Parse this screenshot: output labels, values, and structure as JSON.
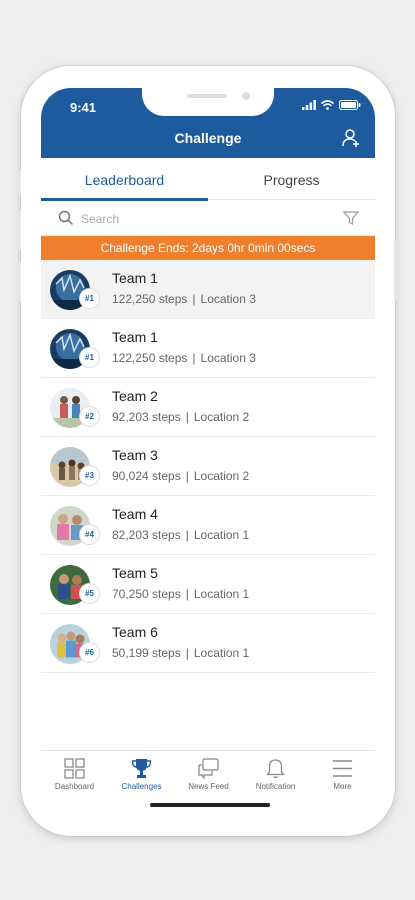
{
  "status_bar": {
    "time": "9:41"
  },
  "header": {
    "title": "Challenge"
  },
  "tabs": [
    {
      "label": "Leaderboard",
      "active": true
    },
    {
      "label": "Progress",
      "active": false
    }
  ],
  "search": {
    "placeholder": "Search",
    "value": ""
  },
  "banner": {
    "text": "Challenge Ends: 2days 0hr 0min 00secs"
  },
  "colors": {
    "primary": "#1d5a9e",
    "accent": "#f07f2d"
  },
  "teams": [
    {
      "rank": "#1",
      "name": "Team 1",
      "steps": "122,250 steps",
      "location": "Location 3"
    },
    {
      "rank": "#1",
      "name": "Team 1",
      "steps": "122,250 steps",
      "location": "Location 3"
    },
    {
      "rank": "#2",
      "name": "Team 2",
      "steps": "92,203 steps",
      "location": "Location 2"
    },
    {
      "rank": "#3",
      "name": "Team 3",
      "steps": "90,024 steps",
      "location": "Location 2"
    },
    {
      "rank": "#4",
      "name": "Team 4",
      "steps": "82,203 steps",
      "location": "Location 1"
    },
    {
      "rank": "#5",
      "name": "Team 5",
      "steps": "70,250 steps",
      "location": "Location 1"
    },
    {
      "rank": "#6",
      "name": "Team 6",
      "steps": "50,199 steps",
      "location": "Location 1"
    }
  ],
  "nav": [
    {
      "label": "Dashboard",
      "icon": "dashboard-icon",
      "active": false
    },
    {
      "label": "Challenges",
      "icon": "trophy-icon",
      "active": true
    },
    {
      "label": "News Feed",
      "icon": "chat-icon",
      "active": false
    },
    {
      "label": "Notification",
      "icon": "bell-icon",
      "active": false
    },
    {
      "label": "More",
      "icon": "menu-icon",
      "active": false
    }
  ]
}
